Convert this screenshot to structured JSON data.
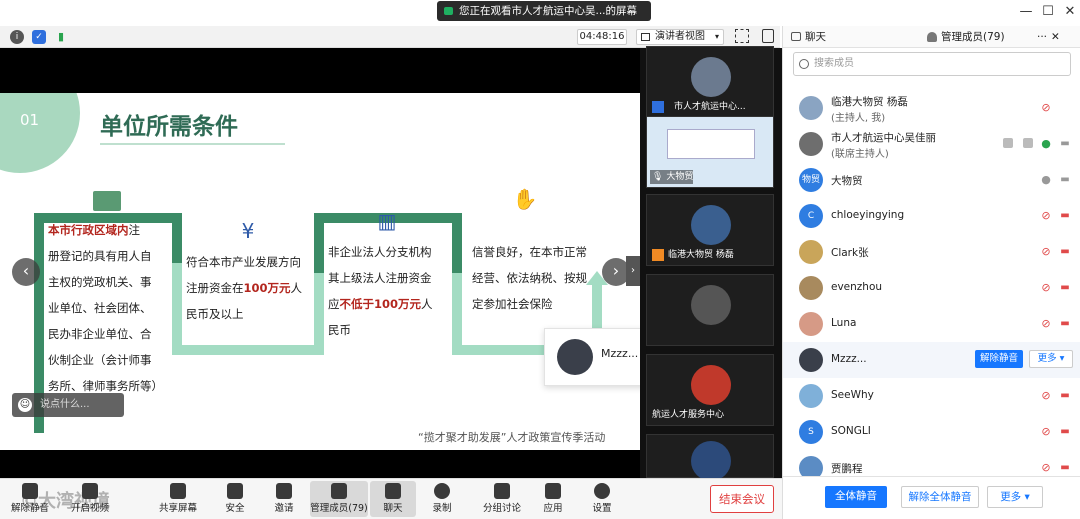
{
  "title_bar": {
    "share_text": "您正在观看市人才航运中心吴...的屏幕",
    "minimize": "—",
    "maximize": "☐",
    "close": "✕"
  },
  "meeting_toolbar": {
    "timer": "04:48:16",
    "view_label": "演讲者视图"
  },
  "slide": {
    "number": "01",
    "heading": "单位所需条件",
    "col1_lines": [
      "本市行政区域内注",
      "册登记的具有用人自",
      "主权的党政机关、事",
      "业单位、社会团体、",
      "民办非企业单位、合",
      "伙制企业（会计师事",
      "务所、律师事务所等）"
    ],
    "col1_red": "本市行政区域内",
    "col1_first_rest": "注",
    "col2_lines": [
      "符合本市产业发展方向",
      "注册资金在100万元人",
      "民币及以上"
    ],
    "col2_line2_pre": "注册资金在",
    "col2_line2_red": "100万元",
    "col2_line2_post": "人",
    "col3_lines": [
      "非企业法人分支机构",
      "其上级法人注册资金",
      "应不低于100万元人",
      "民币"
    ],
    "col3_line3_pre": "应",
    "col3_line3_red": "不低于100万元",
    "col3_line3_post": "人",
    "col4_lines": [
      "信誉良好，在本市正常",
      "经营、依法纳税、按规",
      "定参加社会保险"
    ],
    "footer_note": "“揽才聚才助发展”人才政策宣传季活动",
    "say_placeholder": "说点什么...",
    "prev_arrow": "‹",
    "next_arrow": "›",
    "side_handle": "›"
  },
  "speaker_popup": {
    "name": "Mzzz..."
  },
  "video_tiles": [
    {
      "label": "市人才航运中心..."
    },
    {
      "label": "大物贸"
    },
    {
      "label": "临港大物贸 杨磊"
    },
    {
      "label": ""
    },
    {
      "label": "航运人才服务中心"
    },
    {
      "label": ""
    }
  ],
  "bottom_bar": {
    "items": [
      {
        "label": "解除静音"
      },
      {
        "label": "开启视频"
      },
      {
        "label": "共享屏幕"
      },
      {
        "label": "安全"
      },
      {
        "label": "邀请"
      },
      {
        "label": "管理成员(79)"
      },
      {
        "label": "聊天"
      },
      {
        "label": "录制"
      },
      {
        "label": "分组讨论"
      },
      {
        "label": "应用"
      },
      {
        "label": "设置"
      }
    ],
    "end_label": "结束会议",
    "watermark": "©大湾视境"
  },
  "panel": {
    "tab_chat": "聊天",
    "tab_members": "管理成员(79)",
    "tab_more": "···",
    "tab_close": "✕",
    "search_placeholder": "搜索成员",
    "members": [
      {
        "name": "临港大物贸 杨磊",
        "sub": "(主持人, 我)"
      },
      {
        "name": "市人才航运中心吴佳丽",
        "sub": "(联席主持人)"
      },
      {
        "name": "大物贸",
        "sub": "",
        "avatar_text": "物贸"
      },
      {
        "name": "chloeyingying",
        "sub": "",
        "avatar_text": "C"
      },
      {
        "name": "Clark张",
        "sub": ""
      },
      {
        "name": "evenzhou",
        "sub": ""
      },
      {
        "name": "Luna",
        "sub": ""
      },
      {
        "name": "Mzzz...",
        "sub": ""
      },
      {
        "name": "SeeWhy",
        "sub": ""
      },
      {
        "name": "SONGLI",
        "sub": "",
        "avatar_text": "S"
      },
      {
        "name": "贾鹏程",
        "sub": ""
      }
    ],
    "unmute_label": "解除静音",
    "more_label": "更多 ▾",
    "mute_all": "全体静音",
    "unmute_all": "解除全体静音",
    "more_footer": "更多 ▾"
  },
  "colors": {
    "accent_blue": "#1677ff",
    "slide_green_dark": "#3b8b66",
    "slide_green_light": "#a3dcc3",
    "end_red": "#e04040"
  }
}
